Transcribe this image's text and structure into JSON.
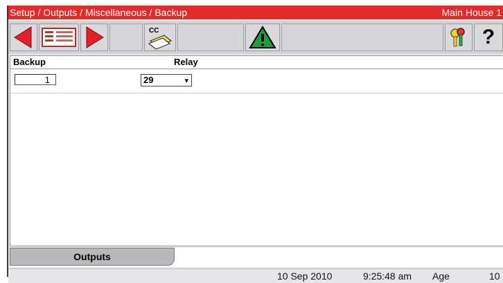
{
  "title_bar": {
    "path": "Setup / Outputs / Miscellaneous / Backup",
    "house": "Main House 1"
  },
  "toolbar": {
    "back_icon": "left-arrow-icon",
    "list_icon": "list-card-icon",
    "forward_icon": "right-arrow-icon",
    "cc_icon": "copy-card-icon",
    "cc_label": "CC",
    "alarm_icon": "alarm-warning-icon",
    "keys_icon": "keys-icon",
    "help_label": "?"
  },
  "table": {
    "headers": [
      "Backup",
      "Relay"
    ],
    "rows": [
      {
        "backup": "1",
        "relay": "29"
      }
    ]
  },
  "tabs": [
    {
      "label": "Outputs"
    }
  ],
  "status_bar": {
    "date": "10 Sep 2010",
    "time": "9:25:48 am",
    "age_label": "Age",
    "age_value": "10"
  },
  "colors": {
    "title_red": "#e42a2a",
    "arrow_red": "#e21f2a",
    "alarm_green": "#1e9e3a"
  }
}
